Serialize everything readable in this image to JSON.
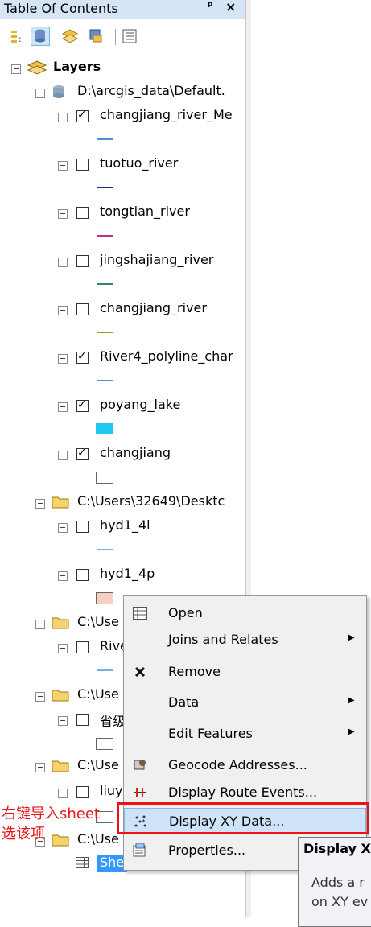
{
  "window": {
    "title": "Table Of Contents",
    "pin_glyph": "ᵢ",
    "close_glyph": "×"
  },
  "toolbar": {
    "icons": [
      "list-by-drawing-order-icon",
      "list-by-source-icon",
      "list-by-visibility-icon",
      "list-by-selection-icon",
      "options-icon"
    ]
  },
  "tree": {
    "root": "Layers",
    "db_path": "D:\\arcgis_data\\Default.",
    "layers": [
      {
        "name": "changjiang_river_Me",
        "checked": true,
        "symbol_color": "#4a8fd8"
      },
      {
        "name": "tuotuo_river",
        "checked": false,
        "symbol_color": "#1b2a8a"
      },
      {
        "name": "tongtian_river",
        "checked": false,
        "symbol_color": "#c0308a"
      },
      {
        "name": "jingshajiang_river",
        "checked": false,
        "symbol_color": "#2a8a70"
      },
      {
        "name": "changjiang_river",
        "checked": false,
        "symbol_color": "#9a9a1a"
      },
      {
        "name": "River4_polyline_char",
        "checked": true,
        "symbol_color": "#4a8fd8"
      },
      {
        "name": "poyang_lake",
        "checked": true,
        "symbol_color": "#1ec8f0"
      },
      {
        "name": "changjiang",
        "checked": true,
        "symbol_color": "#ffffff"
      }
    ],
    "folder1": "C:\\Users\\32649\\Desktc",
    "folder1_layers": [
      {
        "name": "hyd1_4l",
        "checked": false,
        "symbol_color": "#7aaee0"
      },
      {
        "name": "hyd1_4p",
        "checked": false,
        "symbol_color": "#f4cfc2"
      }
    ],
    "folder2": "C:\\Use",
    "folder2_layer": "Rive",
    "folder2_symbol_color": "#7aaee0",
    "folder3": "C:\\Use",
    "folder3_layer": "省级",
    "folder4": "C:\\Use",
    "folder4_layer": "liuy",
    "folder5": "C:\\Use",
    "sheet_label": "She"
  },
  "context_menu": {
    "items": [
      {
        "label": "Open",
        "icon": "table-icon",
        "submenu": false
      },
      {
        "label": "Joins and Relates",
        "icon": "",
        "submenu": true
      },
      {
        "label": "Remove",
        "icon": "remove-x-icon",
        "submenu": false
      },
      {
        "label": "Data",
        "icon": "",
        "submenu": true
      },
      {
        "label": "Edit Features",
        "icon": "",
        "submenu": true
      },
      {
        "label": "Geocode Addresses...",
        "icon": "geocode-icon",
        "submenu": false
      },
      {
        "label": "Display Route Events...",
        "icon": "route-events-icon",
        "submenu": false
      },
      {
        "label": "Display XY Data...",
        "icon": "xy-points-icon",
        "submenu": false,
        "highlighted": true
      },
      {
        "label": "Properties...",
        "icon": "properties-icon",
        "submenu": false
      }
    ],
    "submenu_arrow": "▶"
  },
  "annotation": {
    "line1": "右键导入sheet",
    "line2": "选该项"
  },
  "tooltip": {
    "title": "Display X",
    "line1": "Adds a r",
    "line2": "on XY ev"
  }
}
